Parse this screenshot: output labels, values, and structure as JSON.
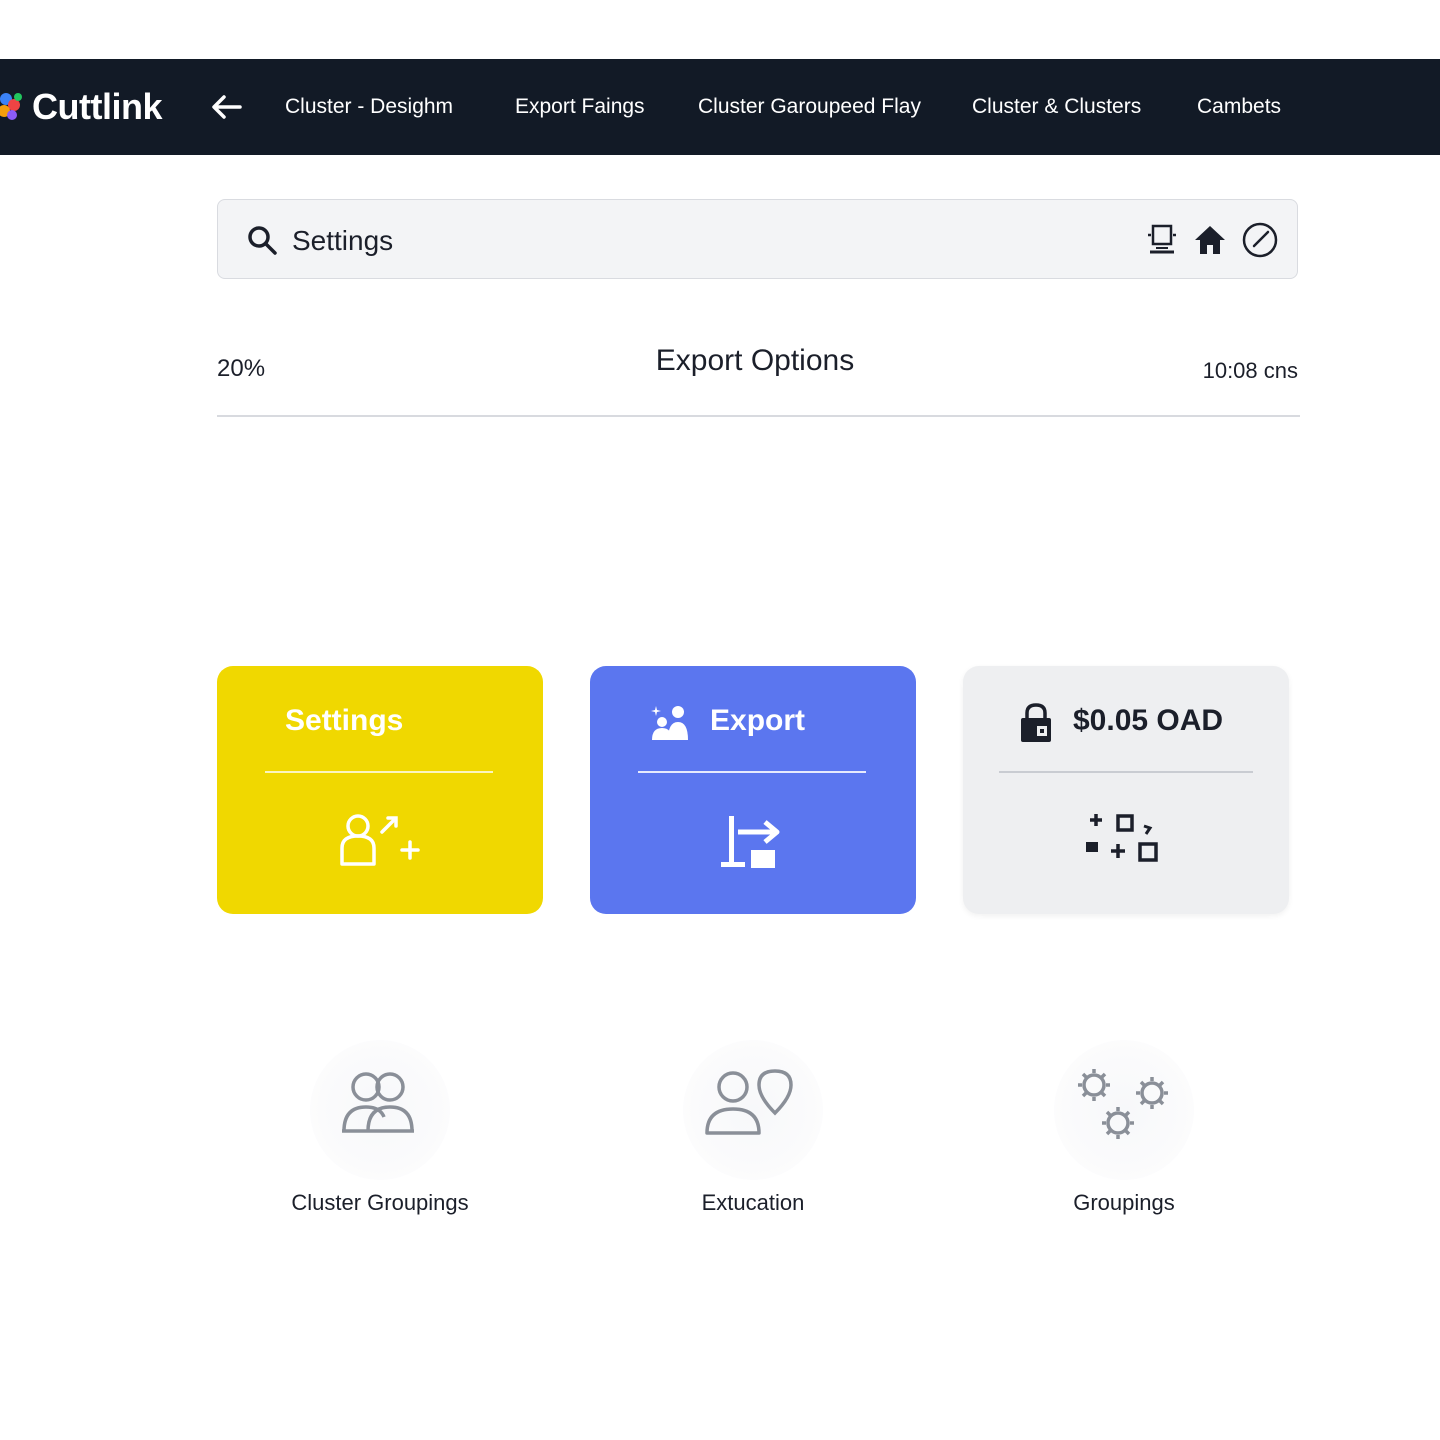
{
  "app": {
    "name": "Cuttlink"
  },
  "nav": {
    "items": [
      {
        "label": "Cluster - Desighm"
      },
      {
        "label": "Export Faings"
      },
      {
        "label": "Cluster Garoupeed Flay"
      },
      {
        "label": "Cluster & Clusters"
      },
      {
        "label": "Cambets"
      }
    ]
  },
  "search": {
    "value": "Settings",
    "icons": [
      "device-icon",
      "home-icon",
      "clock-icon"
    ]
  },
  "header": {
    "progress": "20%",
    "title": "Export Options",
    "time": "10:08 cns"
  },
  "cards": [
    {
      "title": "Settings",
      "color": "#f0d800",
      "head_icon": "",
      "body_icon": "add-user-icon"
    },
    {
      "title": "Export",
      "color": "#5b76ef",
      "head_icon": "users-sparkle-icon",
      "body_icon": "export-arrow-icon"
    },
    {
      "title": "$0.05 OAD",
      "color": "#eeeff1",
      "head_icon": "lock-icon",
      "body_icon": "grid-shapes-icon"
    }
  ],
  "features": [
    {
      "label": "Cluster Groupings",
      "icon": "users-group-icon"
    },
    {
      "label": "Extucation",
      "icon": "user-pin-icon"
    },
    {
      "label": "Groupings",
      "icon": "gears-icon"
    }
  ],
  "colors": {
    "navbar": "#121a26",
    "accent_yellow": "#f0d800",
    "accent_blue": "#5b76ef",
    "icon_gray": "#8a8f98"
  }
}
